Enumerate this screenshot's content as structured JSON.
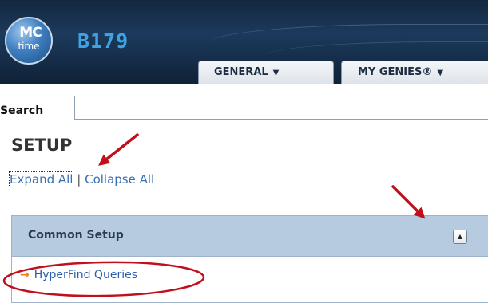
{
  "header": {
    "logo": {
      "line1": "MC",
      "line2": "time"
    },
    "site_name": "B179",
    "tabs": [
      {
        "label": "GENERAL",
        "caret": "▼"
      },
      {
        "label": "MY GENIES®",
        "caret": "▼"
      }
    ]
  },
  "search": {
    "label": "Search",
    "value": "",
    "placeholder": ""
  },
  "setup": {
    "title": "SETUP",
    "expand_all": "Expand All",
    "separator": "|",
    "collapse_all": "Collapse All"
  },
  "panel": {
    "title": "Common Setup",
    "collapse_icon": "▲",
    "items": [
      {
        "label": "HyperFind Queries",
        "bullet": "→"
      }
    ]
  },
  "colors": {
    "header_bg": "#1c3a5c",
    "site_name": "#3ea3e6",
    "link": "#3a6fb2",
    "panel_header": "#b7cbe0",
    "bullet_arrow": "#f07c14",
    "annotation_red": "#c0101b"
  }
}
